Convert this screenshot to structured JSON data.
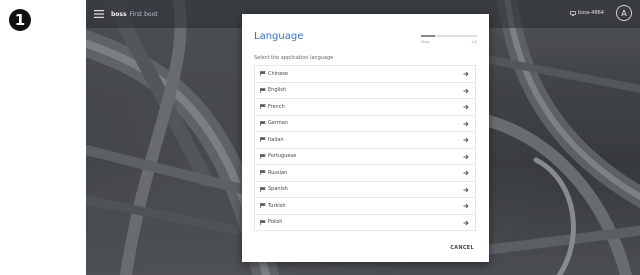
{
  "step_badge": "1",
  "topbar": {
    "brand": "boss",
    "page_name": "First boot",
    "device_label": "boss-4864",
    "avatar_letter": "A"
  },
  "dialog": {
    "title": "Language",
    "subtitle": "Select the application language",
    "progress": {
      "start_label": "Step",
      "end_label": "1/4",
      "fraction": 0.25
    },
    "languages": [
      {
        "label": "Chinese"
      },
      {
        "label": "English"
      },
      {
        "label": "French"
      },
      {
        "label": "German"
      },
      {
        "label": "Italian"
      },
      {
        "label": "Portuguese"
      },
      {
        "label": "Russian"
      },
      {
        "label": "Spanish"
      },
      {
        "label": "Turkish"
      },
      {
        "label": "Polish"
      }
    ],
    "cancel_label": "CANCEL"
  },
  "colors": {
    "accent": "#3b72c2",
    "item_border": "#e6e6e6"
  },
  "icons": {
    "menu": "menu-icon",
    "device": "display-icon",
    "flag": "flag-icon",
    "arrow": "arrow-right-icon"
  }
}
